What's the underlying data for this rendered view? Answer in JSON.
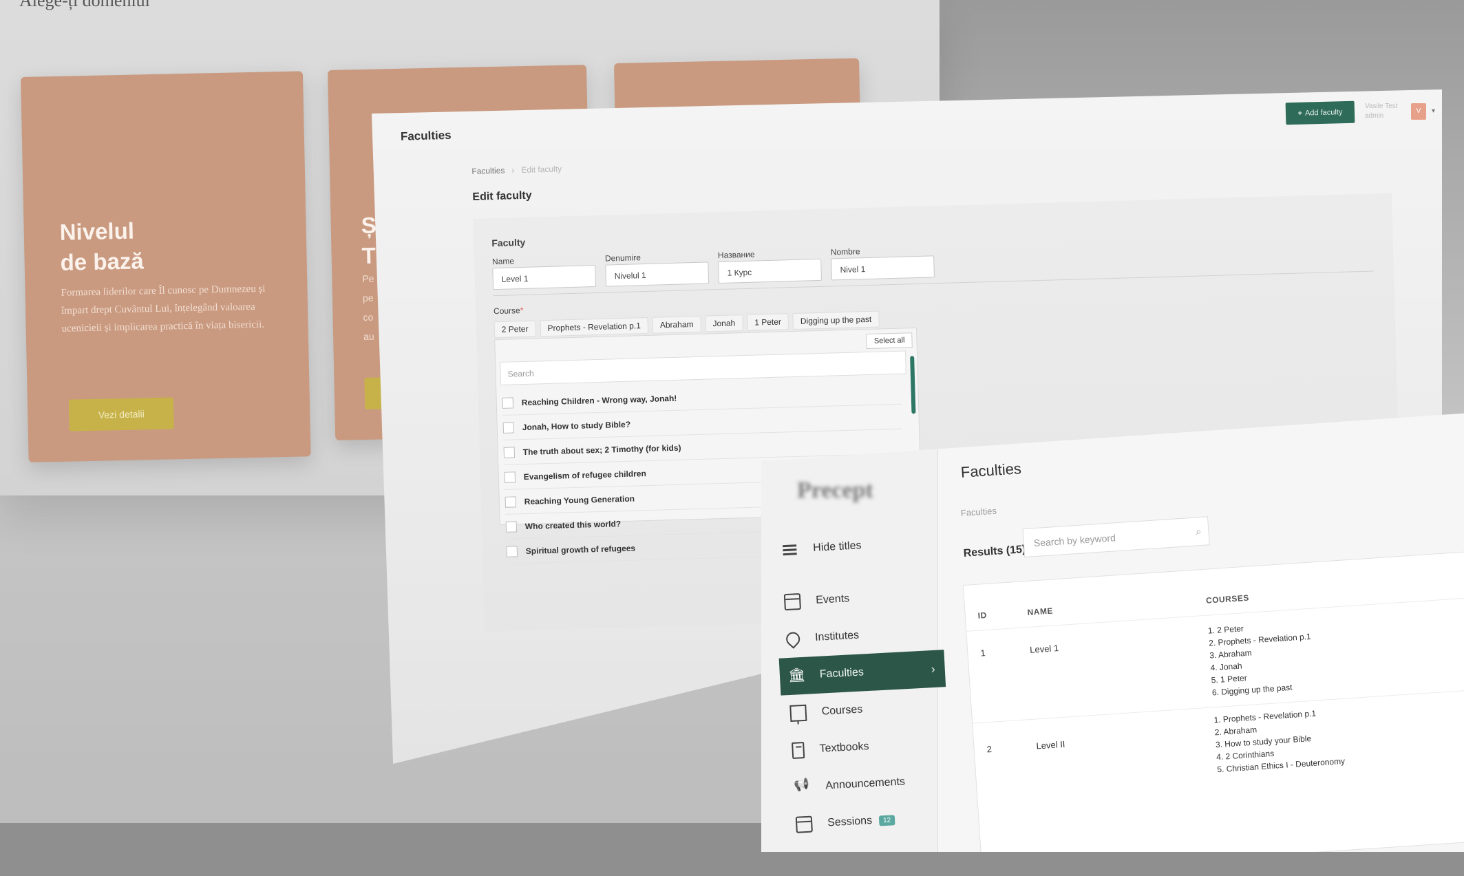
{
  "landing": {
    "heading": "Alege-ți domeniul",
    "card1": {
      "title_line1": "Nivelul",
      "title_line2": "de bază",
      "text": "Formarea liderilor care Îl cunosc pe Dumnezeu și împart drept Cuvântul Lui, înțelegând valoarea ucenicieii și implicarea practică în viața bisericii.",
      "button": "Vezi detalii"
    },
    "card2": {
      "title_line1": "Ș",
      "title_line2": "T",
      "text": "Pe pe co au"
    }
  },
  "edit_page": {
    "title": "Faculties",
    "add_button": "Add faculty",
    "user_name": "Vasile Test",
    "user_role": "admin",
    "user_initial": "V",
    "breadcrumb": [
      "Faculties",
      "Edit faculty"
    ],
    "heading": "Edit faculty",
    "section_label": "Faculty",
    "fields": [
      {
        "label": "Name",
        "value": "Level 1"
      },
      {
        "label": "Denumire",
        "value": "Nivelul 1"
      },
      {
        "label": "Название",
        "value": "1 Курс"
      },
      {
        "label": "Nombre",
        "value": "Nivel 1"
      }
    ],
    "course_label": "Course",
    "selected_courses": [
      "2 Peter",
      "Prophets - Revelation p.1",
      "Abraham",
      "Jonah",
      "1 Peter",
      "Digging up the past"
    ],
    "select_all": "Select all",
    "search_placeholder": "Search",
    "course_options": [
      "Reaching Children - Wrong way, Jonah!",
      "Jonah, How to study Bible?",
      "The truth about sex; 2 Timothy (for kids)",
      "Evangelism of refugee children",
      "Reaching Young Generation",
      "Who created this world?",
      "Spiritual growth of refugees"
    ]
  },
  "list_page": {
    "logo": "Precept",
    "nav": [
      {
        "label": "Hide titles",
        "icon": "menu-lines-icon"
      },
      {
        "label": "Events",
        "icon": "calendar-icon"
      },
      {
        "label": "Institutes",
        "icon": "location-pin-icon"
      },
      {
        "label": "Faculties",
        "icon": "bank-icon",
        "active": true
      },
      {
        "label": "Courses",
        "icon": "presentation-board-icon"
      },
      {
        "label": "Textbooks",
        "icon": "book-icon"
      },
      {
        "label": "Announcements",
        "icon": "megaphone-icon"
      },
      {
        "label": "Sessions",
        "icon": "session-icon",
        "badge": "12"
      }
    ],
    "title": "Faculties",
    "breadcrumb": "Faculties",
    "results_label": "Results (15)",
    "search_placeholder": "Search by keyword",
    "table": {
      "columns": [
        "ID",
        "NAME",
        "COURSES"
      ],
      "rows": [
        {
          "id": "1",
          "name": "Level 1",
          "courses": [
            "1. 2 Peter",
            "2. Prophets - Revelation p.1",
            "3. Abraham",
            "4. Jonah",
            "5. 1 Peter",
            "6. Digging up the past"
          ]
        },
        {
          "id": "2",
          "name": "Level II",
          "courses": [
            "1. Prophets - Revelation p.1",
            "2. Abraham",
            "3. How to study your Bible",
            "4. 2 Corinthians",
            "5. Christian Ethics I - Deuteronomy"
          ]
        }
      ]
    }
  },
  "colors": {
    "card": "#c99a80",
    "card_button": "#c7b24a",
    "accent_green": "#2e6b58",
    "sidebar_active": "#2c5748"
  }
}
